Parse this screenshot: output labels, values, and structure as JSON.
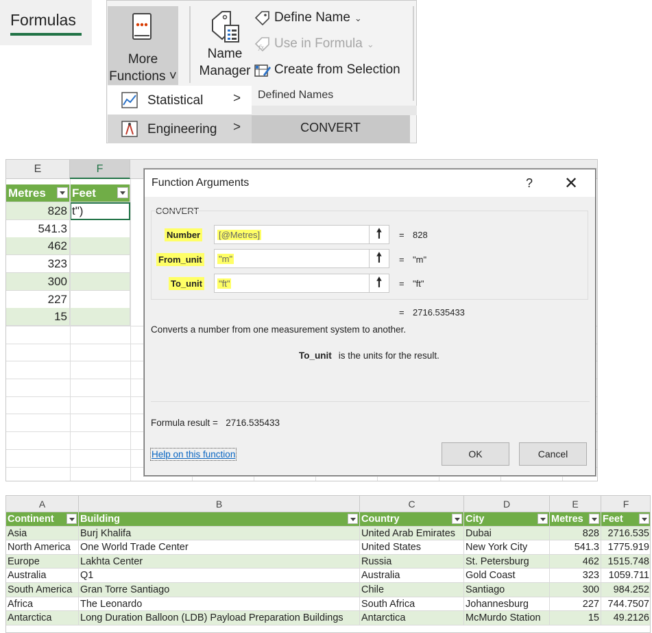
{
  "tab": {
    "label": "Formulas"
  },
  "ribbon": {
    "more_functions": {
      "line1": "More",
      "line2": "Functions ˅"
    },
    "name_manager": {
      "line1": "Name",
      "line2": "Manager"
    },
    "define_name": "Define Name",
    "use_in_formula": "Use in Formula",
    "create_from_selection": "Create from Selection",
    "group_label": "Defined Names",
    "menu": [
      {
        "label": "Statistical",
        "icon": "chart-line-icon"
      },
      {
        "label": "Engineering",
        "icon": "compass-icon"
      }
    ],
    "submenu_item": "CONVERT",
    "accent": "#217346"
  },
  "sheet": {
    "col_e": "E",
    "col_f": "F",
    "hdr_metres": "Metres",
    "hdr_feet": "Feet",
    "active_cell": "t\")",
    "metres": [
      "828",
      "541.3",
      "462",
      "323",
      "300",
      "227",
      "15"
    ]
  },
  "dialog": {
    "title": "Function Arguments",
    "help": "?",
    "function_name": "CONVERT",
    "args": [
      {
        "label": "Number",
        "value": "[@Metres]",
        "result": "828"
      },
      {
        "label": "From_unit",
        "value": "\"m\"",
        "result": "\"m\""
      },
      {
        "label": "To_unit",
        "value": "\"ft\"",
        "result": "\"ft\""
      }
    ],
    "eq": "=",
    "total_result": "2716.535433",
    "description": "Converts a number from one measurement system to another.",
    "arg_name": "To_unit",
    "arg_desc": "is the units for the result.",
    "formula_result_label": "Formula result =",
    "formula_result_value": "2716.535433",
    "help_link": "Help on this function",
    "ok": "OK",
    "cancel": "Cancel"
  },
  "table": {
    "col_letters": [
      "A",
      "B",
      "C",
      "D",
      "E",
      "F"
    ],
    "headers": [
      "Continent",
      "Building",
      "Country",
      "City",
      "Metres",
      "Feet"
    ],
    "rows": [
      [
        "Asia",
        "Burj Khalifa",
        "United Arab Emirates",
        "Dubai",
        "828",
        "2716.535"
      ],
      [
        "North America",
        "One World Trade Center",
        "United States",
        "New York City",
        "541.3",
        "1775.919"
      ],
      [
        "Europe",
        "Lakhta Center",
        "Russia",
        "St. Petersburg",
        "462",
        "1515.748"
      ],
      [
        "Australia",
        "Q1",
        "Australia",
        "Gold Coast",
        "323",
        "1059.711"
      ],
      [
        "South America",
        "Gran Torre Santiago",
        "Chile",
        "Santiago",
        "300",
        "984.252"
      ],
      [
        "Africa",
        "The Leonardo",
        "South Africa",
        "Johannesburg",
        "227",
        "744.7507"
      ],
      [
        "Antarctica",
        "Long Duration Balloon (LDB) Payload Preparation Buildings",
        "Antarctica",
        "McMurdo Station",
        "15",
        "49.2126"
      ]
    ]
  }
}
